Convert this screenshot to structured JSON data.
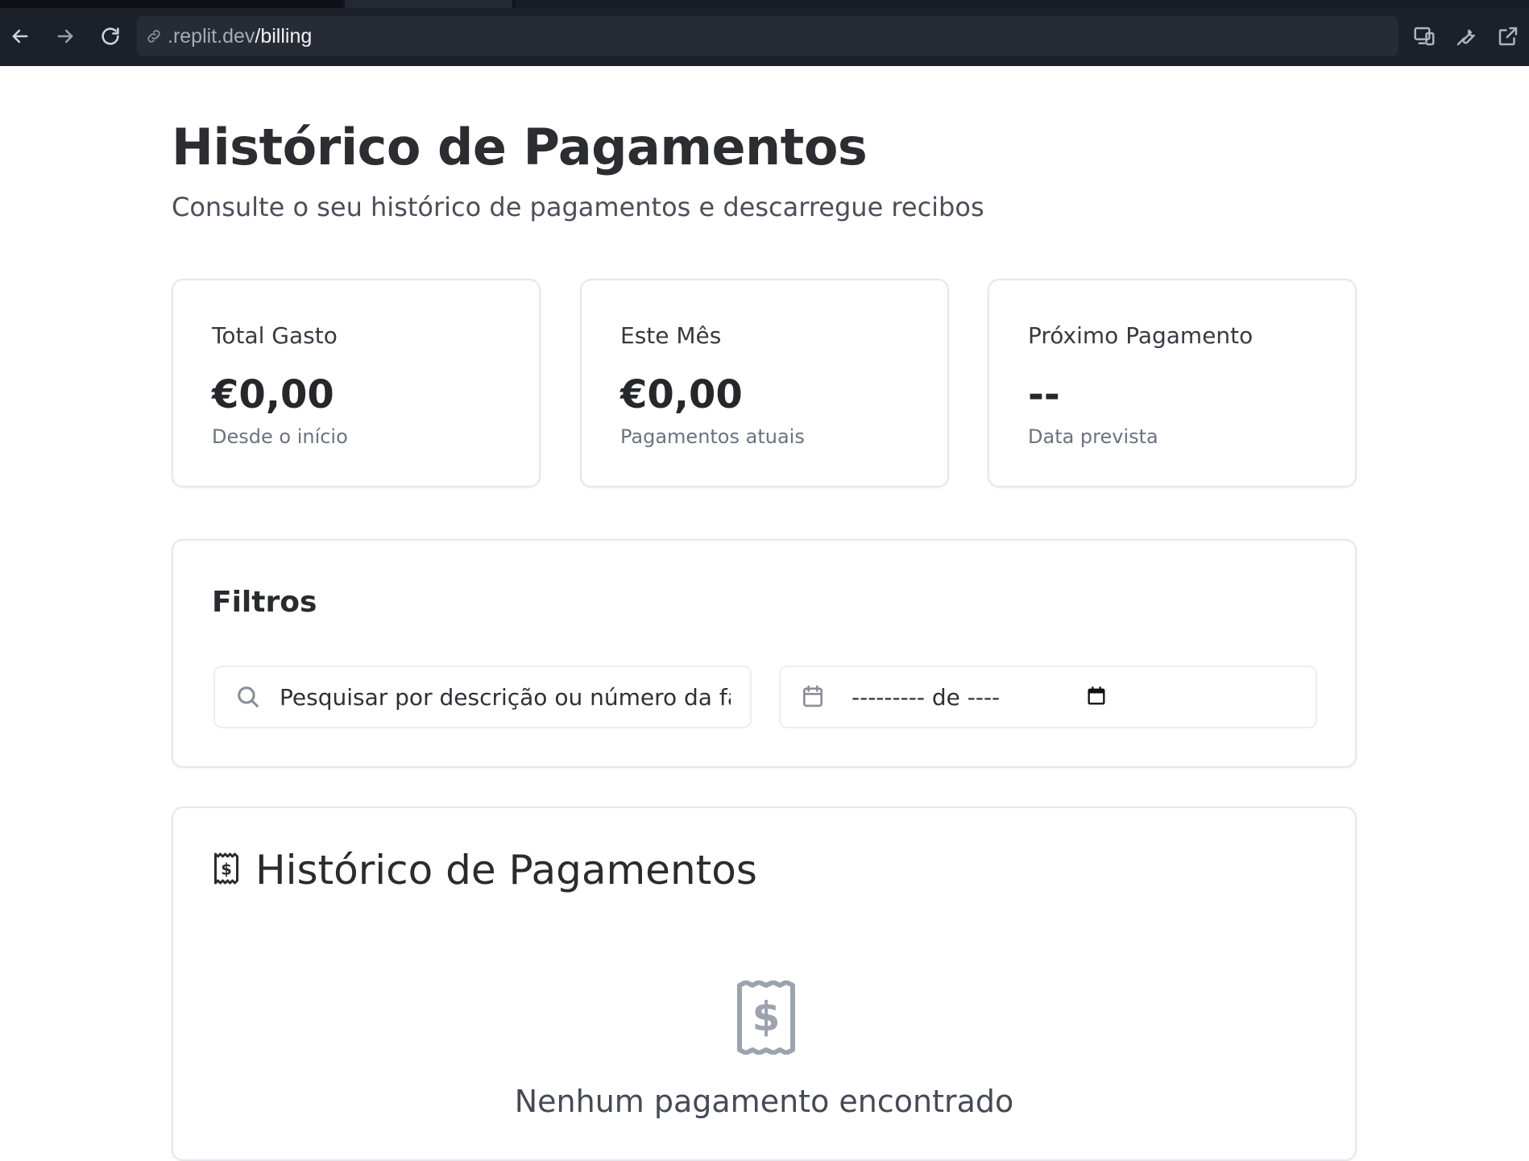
{
  "browser": {
    "url_prefix": ".replit.dev",
    "url_path": "/billing",
    "icons": [
      "back-arrow-icon",
      "forward-arrow-icon",
      "reload-icon",
      "link-icon",
      "devices-icon",
      "wrench-icon",
      "external-link-icon"
    ]
  },
  "page": {
    "title": "Histórico de Pagamentos",
    "subtitle": "Consulte o seu histórico de pagamentos e descarregue recibos"
  },
  "stats": [
    {
      "label": "Total Gasto",
      "value": "€0,00",
      "sub": "Desde o início"
    },
    {
      "label": "Este Mês",
      "value": "€0,00",
      "sub": "Pagamentos atuais"
    },
    {
      "label": "Próximo Pagamento",
      "value": "--",
      "sub": "Data prevista"
    }
  ],
  "filters": {
    "title": "Filtros",
    "search_placeholder": "Pesquisar por descrição ou número da fatura",
    "month_value": "--------- de ----"
  },
  "history": {
    "title": "Histórico de Pagamentos",
    "empty_message": "Nenhum pagamento encontrado"
  },
  "colors": {
    "chrome_bg": "#1c2028",
    "card_border": "#e5e7eb",
    "icon_gray": "#9ca3af"
  }
}
